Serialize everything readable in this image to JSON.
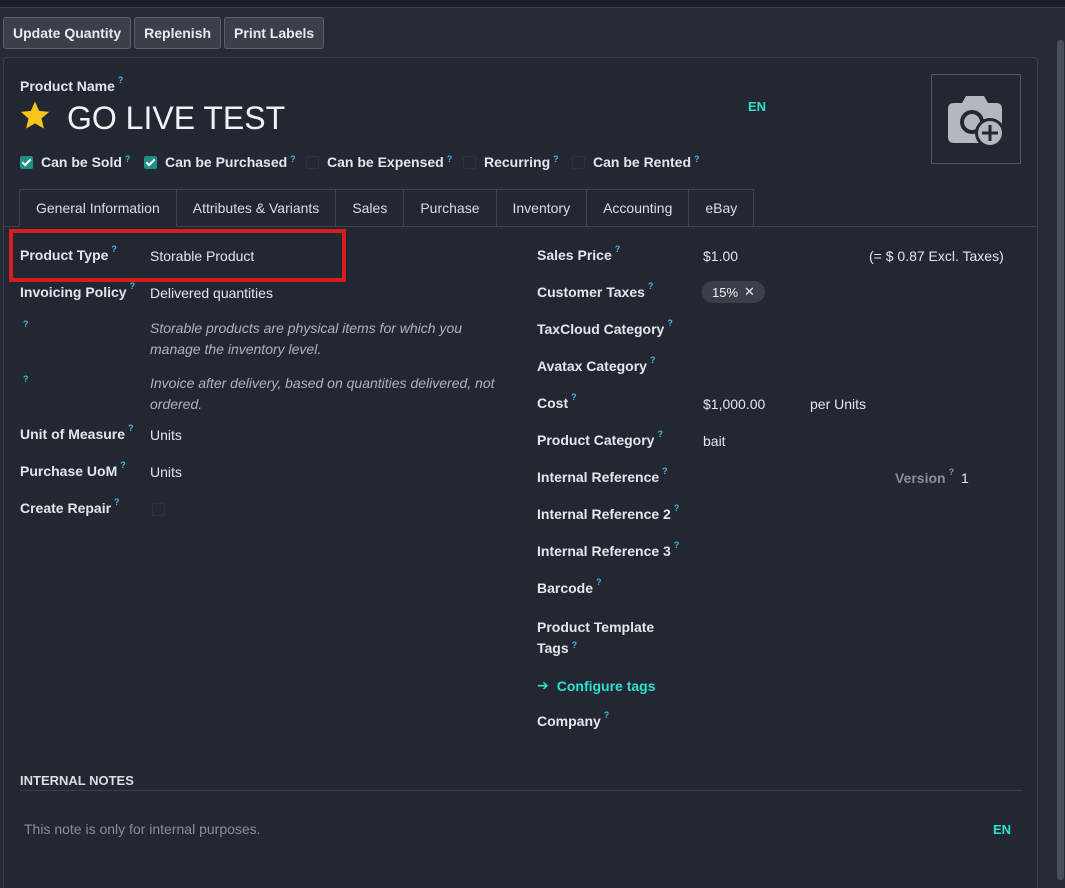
{
  "toolbar": {
    "update_quantity": "Update Quantity",
    "replenish": "Replenish",
    "print_labels": "Print Labels"
  },
  "product": {
    "name_label": "Product Name",
    "name": "GO LIVE TEST",
    "lang": "EN",
    "favorite_icon": "star-icon",
    "photo_icon": "camera-add-icon"
  },
  "flags": [
    {
      "label": "Can be Sold",
      "checked": true
    },
    {
      "label": "Can be Purchased",
      "checked": true
    },
    {
      "label": "Can be Expensed",
      "checked": false
    },
    {
      "label": "Recurring",
      "checked": false
    },
    {
      "label": "Can be Rented",
      "checked": false
    }
  ],
  "tabs": [
    {
      "label": "General Information",
      "active": true
    },
    {
      "label": "Attributes & Variants"
    },
    {
      "label": "Sales"
    },
    {
      "label": "Purchase"
    },
    {
      "label": "Inventory"
    },
    {
      "label": "Accounting"
    },
    {
      "label": "eBay"
    }
  ],
  "left": {
    "product_type_label": "Product Type",
    "product_type": "Storable Product",
    "invoicing_policy_label": "Invoicing Policy",
    "invoicing_policy": "Delivered quantities",
    "help_type": "Storable products are physical items for which you manage the inventory level.",
    "help_type_l1": "Storable products are physical items for which you",
    "help_type_l2": "manage the inventory level.",
    "help_invoice_l1": "Invoice after delivery, based on quantities delivered, not",
    "help_invoice_l2": "ordered.",
    "uom_label": "Unit of Measure",
    "uom": "Units",
    "purchase_uom_label": "Purchase UoM",
    "purchase_uom": "Units",
    "create_repair_label": "Create Repair",
    "create_repair": false
  },
  "right": {
    "sales_price_label": "Sales Price",
    "sales_price": "$1.00",
    "excl_taxes": "(= $ 0.87 Excl. Taxes)",
    "customer_taxes_label": "Customer Taxes",
    "customer_tax_tag": "15%",
    "taxcloud_label": "TaxCloud Category",
    "avatax_label": "Avatax Category",
    "cost_label": "Cost",
    "cost": "$1,000.00",
    "cost_unit": "per Units",
    "category_label": "Product Category",
    "category": "bait",
    "internal_ref_label": "Internal Reference",
    "version_label": "Version",
    "version": "1",
    "internal_ref2_label": "Internal Reference 2",
    "internal_ref3_label": "Internal Reference 3",
    "barcode_label": "Barcode",
    "template_tags_l1": "Product Template",
    "template_tags_l2": "Tags",
    "configure_tags": "Configure tags",
    "company_label": "Company"
  },
  "notes": {
    "heading": "INTERNAL NOTES",
    "placeholder": "This note is only for internal purposes.",
    "lang": "EN"
  },
  "colors": {
    "accent": "#2de0d0",
    "help": "#3fb8e8",
    "highlight": "#d21e1e",
    "checkbox": "#1f8f86"
  }
}
